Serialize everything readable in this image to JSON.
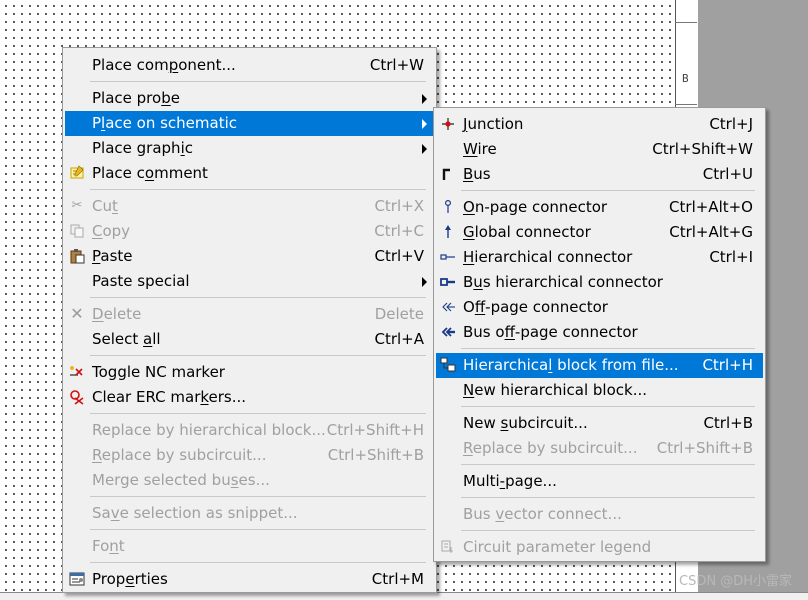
{
  "canvas": {
    "zone_label": "B"
  },
  "watermark": "CSDN @DH小雷家",
  "colors": {
    "highlight": "#0078d7",
    "menu_bg": "#f0f0f0",
    "disabled_text": "#a0a0a0"
  },
  "context_menu": {
    "items": [
      {
        "pre": "Place com",
        "key": "p",
        "post": "onent...",
        "shortcut": "Ctrl+W",
        "icon": "",
        "enabled": true
      },
      {
        "pre": "Place pro",
        "key": "b",
        "post": "e",
        "shortcut": "",
        "icon": "",
        "enabled": true,
        "submenu": true
      },
      {
        "pre": "P",
        "key": "l",
        "post": "ace on schematic",
        "shortcut": "",
        "icon": "",
        "enabled": true,
        "submenu": true,
        "highlighted": true
      },
      {
        "pre": "Place graph",
        "key": "i",
        "post": "c",
        "shortcut": "",
        "icon": "",
        "enabled": true,
        "submenu": true
      },
      {
        "pre": "Place c",
        "key": "o",
        "post": "mment",
        "shortcut": "",
        "icon": "comment-icon",
        "enabled": true
      },
      {
        "pre": "Cu",
        "key": "t",
        "post": "",
        "shortcut": "Ctrl+X",
        "icon": "scissors-icon",
        "enabled": false
      },
      {
        "pre": "",
        "key": "C",
        "post": "opy",
        "shortcut": "Ctrl+C",
        "icon": "copy-icon",
        "enabled": false
      },
      {
        "pre": "",
        "key": "P",
        "post": "aste",
        "shortcut": "Ctrl+V",
        "icon": "paste-icon",
        "enabled": true
      },
      {
        "pre": "Paste special",
        "key": "",
        "post": "",
        "shortcut": "",
        "icon": "",
        "enabled": true,
        "submenu": true
      },
      {
        "pre": "",
        "key": "D",
        "post": "elete",
        "shortcut": "Delete",
        "icon": "delete-x-icon",
        "enabled": false
      },
      {
        "pre": "Select ",
        "key": "a",
        "post": "ll",
        "shortcut": "Ctrl+A",
        "icon": "",
        "enabled": true
      },
      {
        "pre": "Toggle NC marker",
        "key": "",
        "post": "",
        "shortcut": "",
        "icon": "nc-marker-icon",
        "enabled": true
      },
      {
        "pre": "Clear ERC mar",
        "key": "k",
        "post": "ers...",
        "shortcut": "",
        "icon": "clear-erc-icon",
        "enabled": true
      },
      {
        "pre": "Replace by hierarchical block...",
        "key": "",
        "post": "",
        "shortcut": "Ctrl+Shift+H",
        "icon": "",
        "enabled": false
      },
      {
        "pre": "",
        "key": "R",
        "post": "eplace by subcircuit...",
        "shortcut": "Ctrl+Shift+B",
        "icon": "",
        "enabled": false
      },
      {
        "pre": "Merge selected bu",
        "key": "s",
        "post": "es...",
        "shortcut": "",
        "icon": "",
        "enabled": false
      },
      {
        "pre": "Sa",
        "key": "v",
        "post": "e selection as snippet...",
        "shortcut": "",
        "icon": "",
        "enabled": false
      },
      {
        "pre": "Fo",
        "key": "n",
        "post": "t",
        "shortcut": "",
        "icon": "",
        "enabled": false
      },
      {
        "pre": "Prop",
        "key": "e",
        "post": "rties",
        "shortcut": "Ctrl+M",
        "icon": "properties-icon",
        "enabled": true
      }
    ]
  },
  "submenu": {
    "items": [
      {
        "pre": "",
        "key": "J",
        "post": "unction",
        "shortcut": "Ctrl+J",
        "icon": "junction-icon",
        "enabled": true
      },
      {
        "pre": "",
        "key": "W",
        "post": "ire",
        "shortcut": "Ctrl+Shift+W",
        "icon": "",
        "enabled": true
      },
      {
        "pre": "",
        "key": "B",
        "post": "us",
        "shortcut": "Ctrl+U",
        "icon": "bus-icon",
        "enabled": true
      },
      {
        "pre": "",
        "key": "O",
        "post": "n-page connector",
        "shortcut": "Ctrl+Alt+O",
        "icon": "on-page-connector-icon",
        "enabled": true
      },
      {
        "pre": "",
        "key": "G",
        "post": "lobal connector",
        "shortcut": "Ctrl+Alt+G",
        "icon": "global-connector-icon",
        "enabled": true
      },
      {
        "pre": "",
        "key": "H",
        "post": "ierarchical connector",
        "shortcut": "Ctrl+I",
        "icon": "hierarchical-connector-icon",
        "enabled": true
      },
      {
        "pre": "B",
        "key": "u",
        "post": "s hierarchical connector",
        "shortcut": "",
        "icon": "bus-hierarchical-connector-icon",
        "enabled": true
      },
      {
        "pre": "O",
        "key": "f",
        "post": "f-page connector",
        "shortcut": "",
        "icon": "off-page-connector-icon",
        "enabled": true
      },
      {
        "pre": "Bus o",
        "key": "f",
        "post": "f-page connector",
        "shortcut": "",
        "icon": "bus-off-page-connector-icon",
        "enabled": true
      },
      {
        "pre": "Hierarchica",
        "key": "l",
        "post": " block from file...",
        "shortcut": "Ctrl+H",
        "icon": "hierarchical-block-file-icon",
        "enabled": true,
        "highlighted": true
      },
      {
        "pre": "",
        "key": "N",
        "post": "ew hierarchical block...",
        "shortcut": "",
        "icon": "",
        "enabled": true
      },
      {
        "pre": "New ",
        "key": "s",
        "post": "ubcircuit...",
        "shortcut": "Ctrl+B",
        "icon": "",
        "enabled": true
      },
      {
        "pre": "",
        "key": "R",
        "post": "eplace by subcircuit...",
        "shortcut": "Ctrl+Shift+B",
        "icon": "",
        "enabled": false
      },
      {
        "pre": "Multi",
        "key": "-",
        "post": "page...",
        "shortcut": "",
        "icon": "",
        "enabled": true
      },
      {
        "pre": "Bus ",
        "key": "v",
        "post": "ector connect...",
        "shortcut": "",
        "icon": "",
        "enabled": false
      },
      {
        "pre": "Circuit parameter legend",
        "key": "",
        "post": "",
        "shortcut": "",
        "icon": "parameter-legend-icon",
        "enabled": false
      }
    ]
  }
}
